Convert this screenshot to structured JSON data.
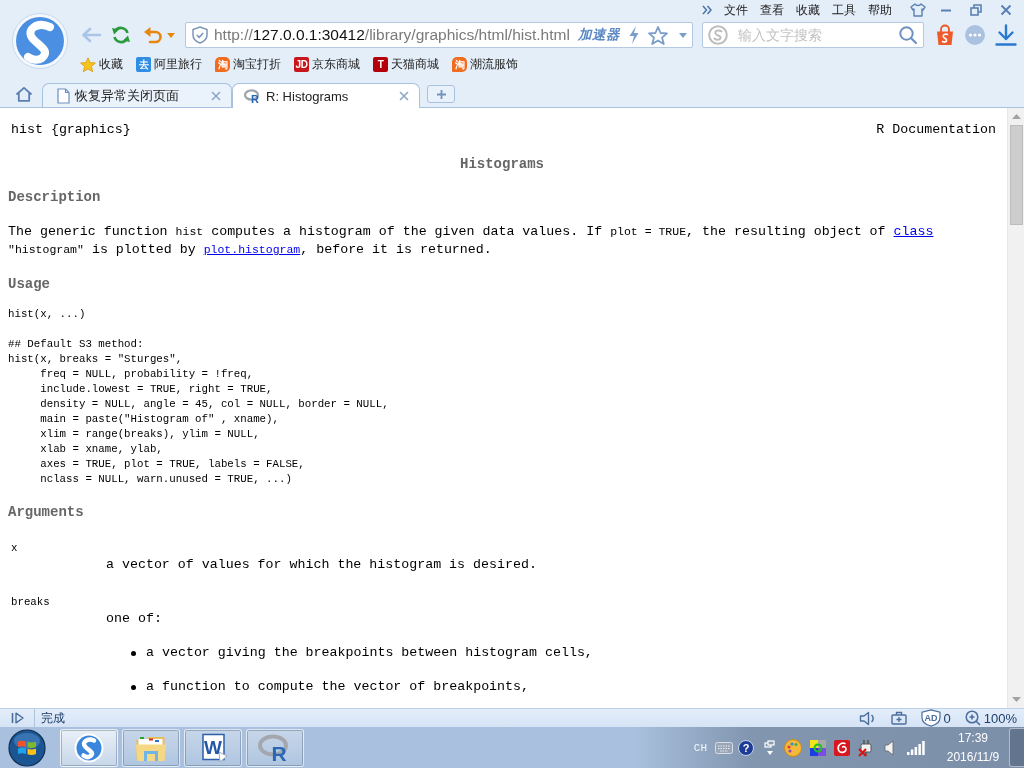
{
  "menu": [
    "文件",
    "查看",
    "收藏",
    "工具",
    "帮助"
  ],
  "toolbar": {
    "back": {
      "disabled": true
    },
    "address": {
      "scheme": "http://",
      "host": "127.0.0.1:30412",
      "path": "/library/graphics/html/hist.html"
    },
    "accelerator": "加速器",
    "search": {
      "placeholder": "输入文字搜索"
    }
  },
  "bookmarks": [
    {
      "kind": "star",
      "label": "收藏"
    },
    {
      "kind": "tile",
      "label": "阿里旅行",
      "icon_text": "去",
      "color": "#2f8de4"
    },
    {
      "kind": "bubble",
      "label": "淘宝打折",
      "icon_text": "淘",
      "color": "#f26c1f"
    },
    {
      "kind": "tile",
      "label": "京东商城",
      "icon_text": "JD",
      "color": "#c8161d"
    },
    {
      "kind": "tile",
      "label": "天猫商城",
      "icon_text": "T",
      "color": "#b5000c"
    },
    {
      "kind": "bubble",
      "label": "潮流服饰",
      "icon_text": "淘",
      "color": "#f26c1f"
    }
  ],
  "tabs": [
    {
      "kind": "page",
      "label": "恢复异常关闭页面",
      "selected": false
    },
    {
      "kind": "r",
      "icon_text": "R",
      "label": "R: Histograms",
      "selected": true
    }
  ],
  "page": {
    "header": {
      "left": "hist {graphics}",
      "right": "R Documentation"
    },
    "title": "Histograms",
    "sections": [
      {
        "kind": "paragraph",
        "heading": "Description",
        "runs": [
          {
            "kind": "text",
            "text": "The generic function "
          },
          {
            "kind": "code",
            "text": "hist"
          },
          {
            "kind": "text",
            "text": " computes a histogram of the given data values. If "
          },
          {
            "kind": "code",
            "text": "plot = TRUE"
          },
          {
            "kind": "text",
            "text": ", the resulting object of "
          },
          {
            "kind": "link",
            "text": "class"
          },
          {
            "kind": "code",
            "text": " \"histogram\""
          },
          {
            "kind": "text",
            "text": " is plotted by "
          },
          {
            "kind": "code_link",
            "text": "plot.histogram"
          },
          {
            "kind": "text",
            "text": ", before it is returned."
          }
        ]
      },
      {
        "kind": "code",
        "heading": "Usage",
        "code": "hist(x, ...)\n\n## Default S3 method:\nhist(x, breaks = \"Sturges\",\n     freq = NULL, probability = !freq,\n     include.lowest = TRUE, right = TRUE,\n     density = NULL, angle = 45, col = NULL, border = NULL,\n     main = paste(\"Histogram of\" , xname),\n     xlim = range(breaks), ylim = NULL,\n     xlab = xname, ylab,\n     axes = TRUE, plot = TRUE, labels = FALSE,\n     nclass = NULL, warn.unused = TRUE, ...)"
      },
      {
        "kind": "arguments",
        "heading": "Arguments",
        "items": [
          {
            "name": "x",
            "text": "a vector of values for which the histogram is desired."
          },
          {
            "name": "breaks",
            "text": "one of:",
            "bullets": [
              "a vector giving the breakpoints between histogram cells,",
              "a function to compute the vector of breakpoints,"
            ]
          }
        ]
      }
    ]
  },
  "status_bar": {
    "status": "完成",
    "ad_block": {
      "icon_text": "AD",
      "count": "0"
    },
    "zoom": "100%"
  },
  "taskbar": {
    "apps": [
      {
        "kind": "browser",
        "selected": true
      },
      {
        "kind": "folder",
        "selected": false
      },
      {
        "kind": "document",
        "icon_text": "W",
        "selected": false
      },
      {
        "kind": "r",
        "icon_text": "R",
        "selected": false
      }
    ],
    "tray": {
      "language": "CH",
      "help_icon_text": "?",
      "time": "17:39",
      "date": "2016/11/9"
    }
  }
}
